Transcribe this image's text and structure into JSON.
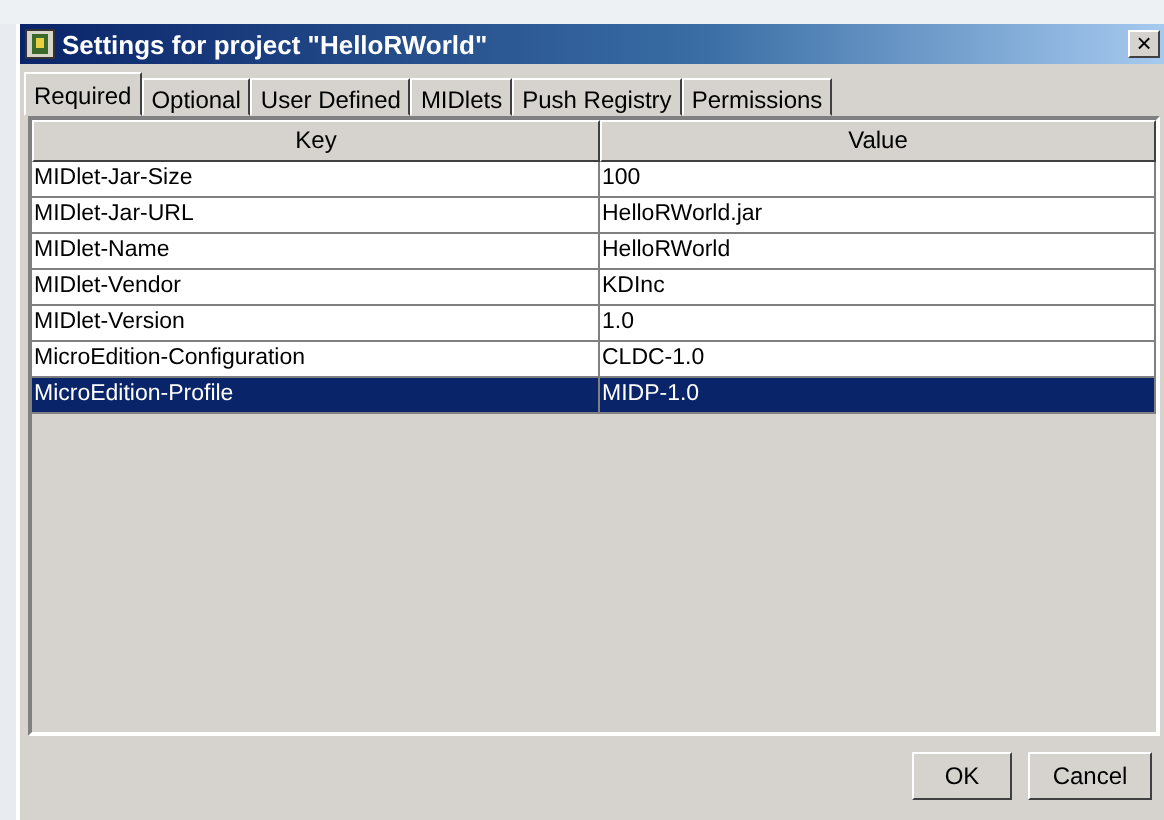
{
  "window": {
    "title": "Settings for project \"HelloRWorld\"",
    "close": "×"
  },
  "tabs": [
    {
      "label": "Required",
      "selected": true
    },
    {
      "label": "Optional",
      "selected": false
    },
    {
      "label": "User Defined",
      "selected": false
    },
    {
      "label": "MIDlets",
      "selected": false
    },
    {
      "label": "Push Registry",
      "selected": false
    },
    {
      "label": "Permissions",
      "selected": false
    }
  ],
  "table": {
    "columns": [
      "Key",
      "Value"
    ],
    "rows": [
      {
        "key": "MIDlet-Jar-Size",
        "value": "100",
        "selected": false
      },
      {
        "key": "MIDlet-Jar-URL",
        "value": "HelloRWorld.jar",
        "selected": false
      },
      {
        "key": "MIDlet-Name",
        "value": "HelloRWorld",
        "selected": false
      },
      {
        "key": "MIDlet-Vendor",
        "value": "KDInc",
        "selected": false
      },
      {
        "key": "MIDlet-Version",
        "value": "1.0",
        "selected": false
      },
      {
        "key": "MicroEdition-Configuration",
        "value": "CLDC-1.0",
        "selected": false
      },
      {
        "key": "MicroEdition-Profile",
        "value": "MIDP-1.0",
        "selected": true
      }
    ]
  },
  "buttons": [
    "OK",
    "Cancel"
  ]
}
